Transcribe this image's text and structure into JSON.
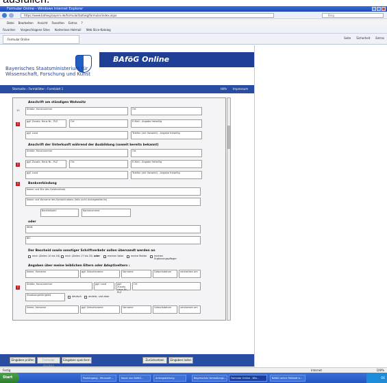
{
  "page_caption": "ausfüllen.",
  "window": {
    "title": "Formular Online - Windows Internet Explorer",
    "url": "https://www.bafoeg.bayern.de/formular/bafoeg/formular/index.aspx",
    "search_placeholder": "Bing"
  },
  "menu": [
    "Datei",
    "Bearbeiten",
    "Ansicht",
    "Favoriten",
    "Extras",
    "?"
  ],
  "favorites": [
    "Favoriten",
    "Vorgeschlagene Sites",
    "Kostenlose Hotmail",
    "Web Slice-Katalog"
  ],
  "tab": {
    "label": "Formular Online"
  },
  "command_bar": [
    "Seite",
    "Sicherheit",
    "Extras"
  ],
  "site": {
    "banner": "BAföG Online",
    "ministry_line1": "Bayerisches Staatsministerium für",
    "ministry_line2": "Wissenschaft, Forschung und Kunst",
    "breadcrumb": "Startseite › Formblätter › Formblatt 1",
    "nav_help": "Hilfe",
    "nav_contact": "Impressum"
  },
  "form": {
    "sec1": "Anschrift am ständigen Wohnsitz",
    "sec2": "Anschrift der Unterkunft während der Ausbildung (soweit bereits bekannt)",
    "sec3": "Bankverbindung",
    "sec4": "Der Bescheid sowie sonstiger Schriftverkehr sollen übersandt werden an",
    "sec5": "Angaben über meine leiblichen Eltern oder Adoptiveltern :",
    "label_strasse": "Straße, Hausnummer",
    "label_plz": "ggf. Zusatz, Haus Nr., PLZ",
    "label_ort": "Ort",
    "label_email": "E-Mail - Angabe freiwillig",
    "label_telefon": "Telefon (mit Vorwahl) - Angabe freiwillig",
    "label_land": "ggf. Land",
    "label_konto": "Name und Sitz des Geldinstituts",
    "label_inhaber": "Name und Vorname des Kontoinhabers (falls nicht Antragsteller/in)",
    "label_bankleitzahl": "Bankleitzahl",
    "label_kontonummer": "Kontonummer",
    "label_iban": "IBAN",
    "label_bic": "BIC",
    "opt1": "mich (Zeilen 10 bis 16)",
    "opt2": "mich (Zeilen 17 bis 20)",
    "opt_oder": "oder",
    "opt3": "meinen Vater",
    "opt4": "meine Mutter",
    "opt5": "meinen Ergänzungspfleger",
    "label_name": "Name, Vorname",
    "label_geburtsname": "ggf. Geburtsname",
    "label_vorname": "Vorname",
    "label_geburtsdatum": "Geburtsdatum",
    "label_verstorben": "verstorben am",
    "label_staatsangehoerigkeit": "Staatsangehörigkeit",
    "opt_deutsch": "deutsch",
    "opt_andere": "andere, und zwar"
  },
  "bottom_buttons": [
    "Eingaben prüfen",
    "Formular drucken",
    "Eingaben speichern",
    "Zurücksetzen",
    "Eingaben laden"
  ],
  "status": {
    "left": "Fertig",
    "zone": "Internet",
    "zoom": "100%"
  },
  "taskbar": {
    "start": "Start",
    "tasks": [
      "Posteingang - Microsoft ...",
      "Kopie von BAföG...",
      "Antragsstellung",
      "Bayerisches Verwaltungs...",
      "Formular Online - Win...",
      "BAföG online Fallblatt b..."
    ],
    "clock": "DE"
  }
}
